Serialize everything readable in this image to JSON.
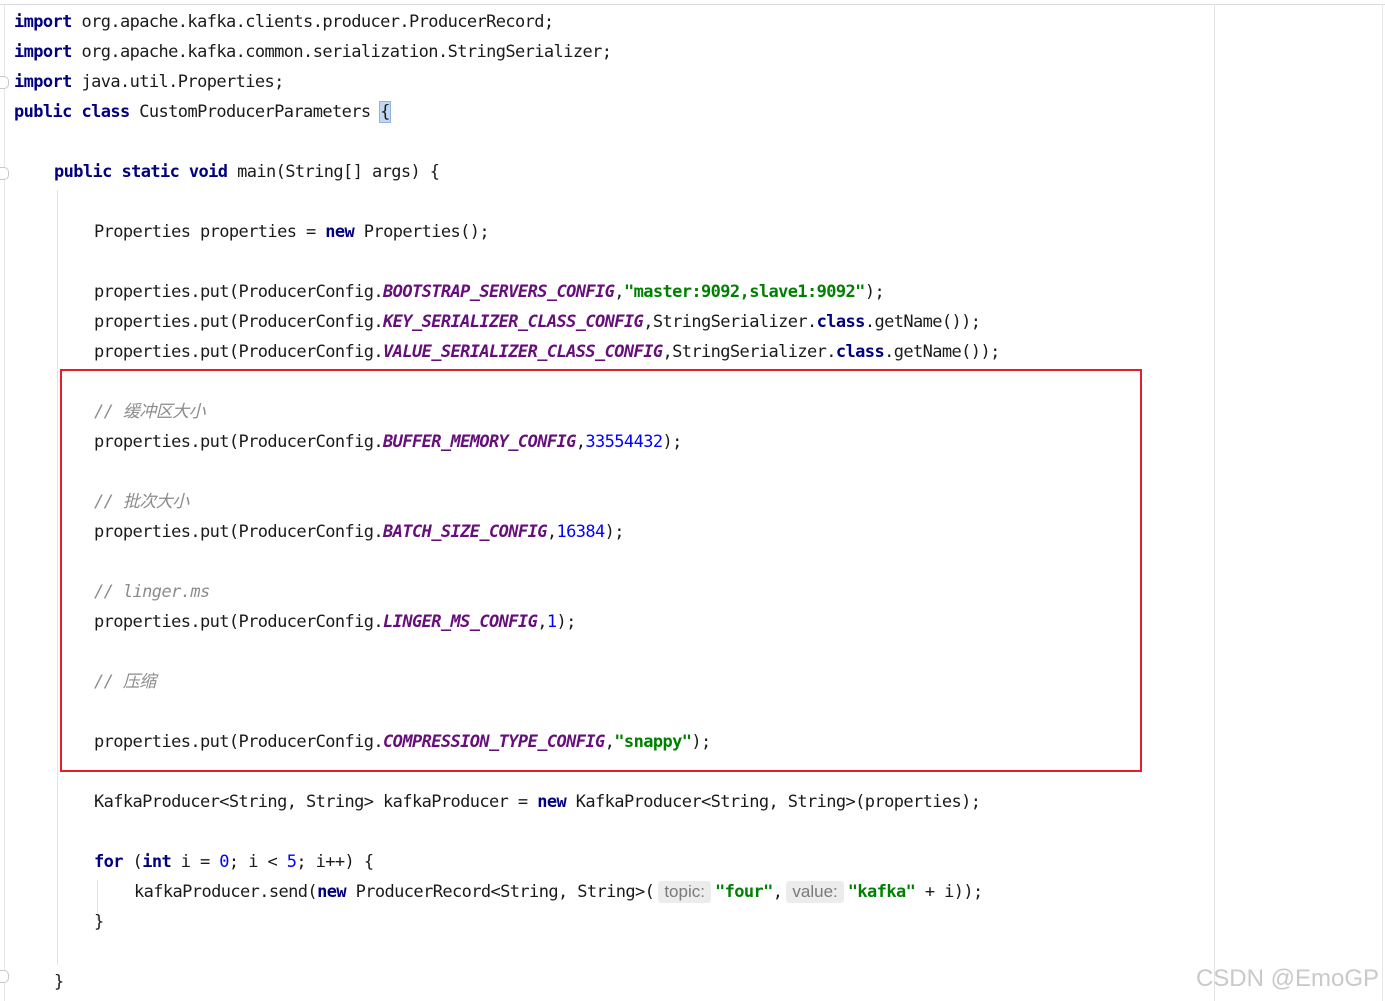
{
  "code": {
    "imports": [
      {
        "keyword": "import",
        "path": "org.apache.kafka.clients.producer.ProducerRecord;"
      },
      {
        "keyword": "import",
        "path": "org.apache.kafka.common.serialization.StringSerializer;"
      },
      {
        "keyword": "import",
        "path": "java.util.Properties;"
      }
    ],
    "class_decl": {
      "modifiers": "public class",
      "name": "CustomProducerParameters",
      "open_brace": "{"
    },
    "main_decl": {
      "modifiers": "public static void",
      "signature": "main(String[] args)",
      "open_brace": "{"
    },
    "properties_line": {
      "pre": "Properties properties = ",
      "kw": "new",
      "post": "Properties();"
    },
    "put_prefix": "properties.put(ProducerConfig.",
    "config_lines": [
      {
        "const": "BOOTSTRAP_SERVERS_CONFIG",
        "sep": ",",
        "value": "\"master:9092,slave1:9092\"",
        "value_type": "str",
        "suffix": ");"
      },
      {
        "const": "KEY_SERIALIZER_CLASS_CONFIG",
        "sep": ",",
        "pre_kw": "StringSerializer.",
        "kw": "class",
        "post_kw": ".getName());"
      },
      {
        "const": "VALUE_SERIALIZER_CLASS_CONFIG",
        "sep": ",",
        "pre_kw": "StringSerializer.",
        "kw": "class",
        "post_kw": ".getName());"
      }
    ],
    "tuning": [
      {
        "comment": "// 缓冲区大小",
        "const": "BUFFER_MEMORY_CONFIG",
        "sep": ",",
        "value": "33554432",
        "value_type": "num",
        "suffix": ");"
      },
      {
        "comment": "// 批次大小",
        "const": "BATCH_SIZE_CONFIG",
        "sep": ",",
        "value": "16384",
        "value_type": "num",
        "suffix": ");"
      },
      {
        "comment": "// linger.ms",
        "const": "LINGER_MS_CONFIG",
        "sep": ",",
        "value": "1",
        "value_type": "num",
        "suffix": ");"
      },
      {
        "comment": "// 压缩",
        "const": "COMPRESSION_TYPE_CONFIG",
        "sep": ",",
        "value": "\"snappy\"",
        "value_type": "str",
        "suffix": ");"
      }
    ],
    "producer_line": {
      "pre": "KafkaProducer<String, String> kafkaProducer = ",
      "kw": "new",
      "post": "KafkaProducer<String, String>(properties);"
    },
    "for_line": {
      "kw": "for",
      "open": " (",
      "kw2": "int",
      "mid1": " i = ",
      "num1": "0",
      "mid2": "; i < ",
      "num2": "5",
      "post": "; i++) {"
    },
    "send_line": {
      "pre": "kafkaProducer.send(",
      "kw": "new",
      "mid": "ProducerRecord<String, String>(",
      "hint_topic": "topic:",
      "topic_value": "\"four\"",
      "comma": ",",
      "hint_value": "value:",
      "value_value": "\"kafka\"",
      "post": " + i));"
    },
    "close_for": "}",
    "close_main": "}"
  },
  "watermark": "CSDN @EmoGP",
  "colors": {
    "keyword": "#000080",
    "constant": "#660e7a",
    "string": "#008000",
    "number": "#0000ff",
    "comment": "#8c8c8c",
    "highlight_border": "#e0202a"
  }
}
